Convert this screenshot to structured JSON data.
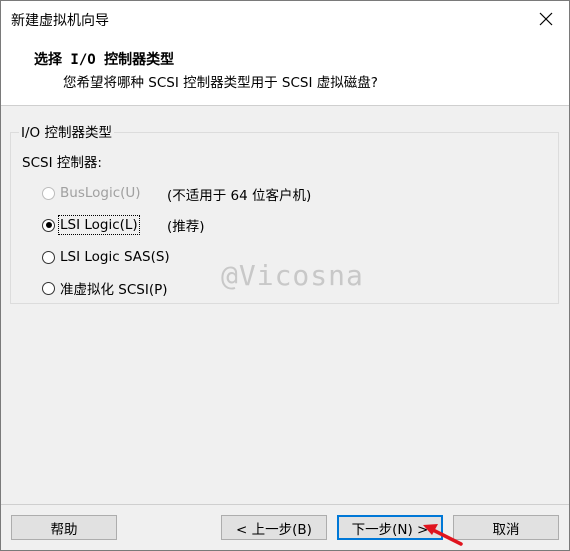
{
  "window": {
    "title": "新建虚拟机向导"
  },
  "header": {
    "title": "选择 I/O 控制器类型",
    "subtitle": "您希望将哪种 SCSI 控制器类型用于 SCSI 虚拟磁盘?"
  },
  "group": {
    "legend": "I/O 控制器类型",
    "scsi_label": "SCSI 控制器:",
    "options": [
      {
        "label": "BusLogic(U)",
        "note": "(不适用于 64 位客户机)",
        "checked": false,
        "disabled": true
      },
      {
        "label": "LSI Logic(L)",
        "note": "(推荐)",
        "checked": true,
        "disabled": false
      },
      {
        "label": "LSI Logic SAS(S)",
        "note": "",
        "checked": false,
        "disabled": false
      },
      {
        "label": "准虚拟化 SCSI(P)",
        "note": "",
        "checked": false,
        "disabled": false
      }
    ]
  },
  "watermark": "@Vicosna",
  "buttons": {
    "help": "帮助",
    "back": "< 上一步(B)",
    "next": "下一步(N) >",
    "cancel": "取消"
  },
  "colors": {
    "accent": "#0078d7",
    "arrow": "#e0141e"
  },
  "icons": {
    "close": "close-icon",
    "annotation": "arrow-icon"
  }
}
